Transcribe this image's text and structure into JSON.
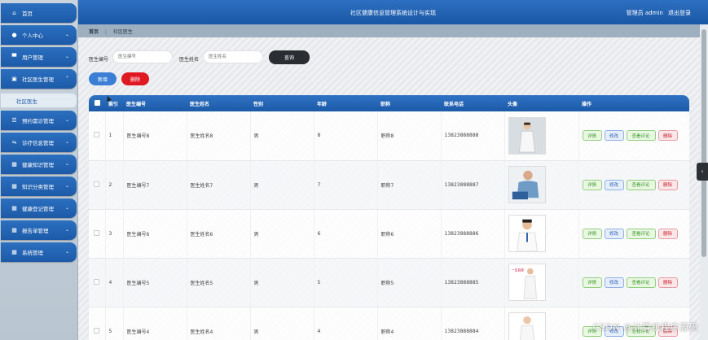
{
  "app_title": "社区健康信息管理系统设计与实现",
  "header": {
    "user_label": "管理员 admin",
    "logout": "退出登录"
  },
  "breadcrumb": {
    "home": "首页",
    "current": "社区医生"
  },
  "sidebar": {
    "items": [
      {
        "label": "首页",
        "icon": "home-icon",
        "has_chevron": false
      },
      {
        "label": "个人中心",
        "icon": "user-icon",
        "has_chevron": true
      },
      {
        "label": "用户管理",
        "icon": "monitor-icon",
        "has_chevron": true
      },
      {
        "label": "社区医生管理",
        "icon": "clipboard-icon",
        "has_chevron": true,
        "expanded": true
      },
      {
        "label": "预约需诊管理",
        "icon": "list-icon",
        "has_chevron": true
      },
      {
        "label": "诊疗信息管理",
        "icon": "sliders-icon",
        "has_chevron": true
      },
      {
        "label": "健康知识管理",
        "icon": "grid-icon",
        "has_chevron": true
      },
      {
        "label": "知识分类管理",
        "icon": "grid-icon",
        "has_chevron": true
      },
      {
        "label": "健康登记管理",
        "icon": "grid-icon",
        "has_chevron": true
      },
      {
        "label": "报告单管理",
        "icon": "grid-icon",
        "has_chevron": true
      },
      {
        "label": "系统管理",
        "icon": "grid-icon",
        "has_chevron": true
      }
    ],
    "sub_item": "社区医生"
  },
  "search": {
    "doctor_no_label": "医生编号",
    "doctor_no_placeholder": "医生编号",
    "doctor_name_label": "医生姓名",
    "doctor_name_placeholder": "医生姓名",
    "query_button": "查询"
  },
  "actions": {
    "add": "新增",
    "delete": "删除"
  },
  "table": {
    "headers": [
      "",
      "索引",
      "医生编号",
      "医生姓名",
      "性别",
      "年龄",
      "职称",
      "联系电话",
      "头像",
      "操作"
    ],
    "rows": [
      {
        "index": "1",
        "doctor_no": "医生编号8",
        "name": "医生姓名8",
        "gender": "男",
        "age": "8",
        "title": "职称8",
        "phone": "13823888888"
      },
      {
        "index": "2",
        "doctor_no": "医生编号7",
        "name": "医生姓名7",
        "gender": "男",
        "age": "7",
        "title": "职称7",
        "phone": "13823888887"
      },
      {
        "index": "3",
        "doctor_no": "医生编号6",
        "name": "医生姓名6",
        "gender": "男",
        "age": "6",
        "title": "职称6",
        "phone": "13823888886"
      },
      {
        "index": "4",
        "doctor_no": "医生编号5",
        "name": "医生姓名5",
        "gender": "男",
        "age": "5",
        "title": "职称5",
        "phone": "13823888885"
      },
      {
        "index": "5",
        "doctor_no": "医生编号4",
        "name": "医生姓名4",
        "gender": "男",
        "age": "4",
        "title": "职称4",
        "phone": "13823888884"
      }
    ],
    "row_ops": {
      "detail": "详情",
      "edit": "修改",
      "review": "查看评论",
      "delete": "删除"
    }
  },
  "watermark": "CSDN @计算机程序源码",
  "colors": {
    "primary": "#1c5aa8",
    "danger": "#e01822",
    "dark_button": "#2a2d32"
  }
}
